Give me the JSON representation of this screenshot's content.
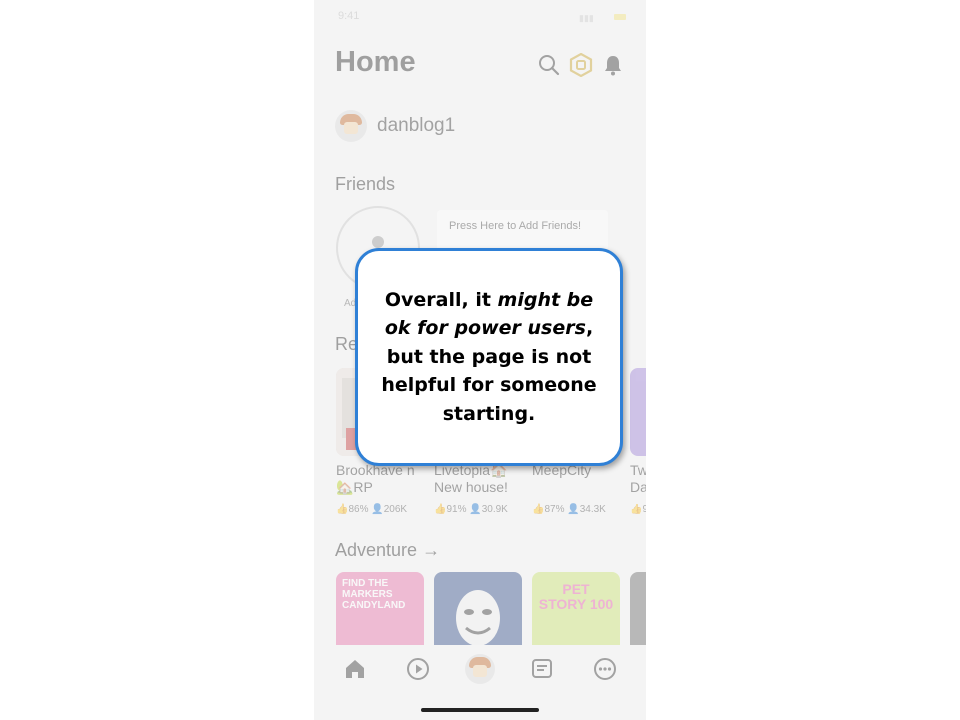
{
  "status_bar": {
    "time": "9:41"
  },
  "header": {
    "title": "Home"
  },
  "user": {
    "name": "danblog1"
  },
  "friends": {
    "label": "Friends",
    "add_caption": "Add Friends",
    "card_text": "Press Here to Add Friends!"
  },
  "recommended": {
    "label": "Recommended",
    "games": [
      {
        "name": "Brookhave n 🏡RP",
        "like": "86%",
        "players": "206K"
      },
      {
        "name": "Livetopia🏠 New house!",
        "like": "91%",
        "players": "30.9K"
      },
      {
        "name": "MeepCity",
        "like": "87%",
        "players": "34.3K"
      },
      {
        "name": "Tw Da",
        "like": "9",
        "players": ""
      }
    ]
  },
  "adventure": {
    "label": "Adventure",
    "tiles": [
      {
        "title": "FIND THE MARKERS CANDYLAND",
        "color": "#e86fa8"
      },
      {
        "title": "",
        "color": "#2f4b87"
      },
      {
        "title": "PET STORY 100",
        "color": "#c7e36b"
      },
      {
        "title": "",
        "color": "#666666"
      }
    ]
  },
  "icons": {
    "search": "search-icon",
    "robux": "robux-icon",
    "bell": "bell-icon",
    "nav": [
      "home-icon",
      "play-icon",
      "avatar-icon",
      "chat-icon",
      "more-icon"
    ]
  },
  "colors": {
    "callout_border": "#2f80d6",
    "background": "#f4f4f4"
  },
  "callout": {
    "part1": "Overall, it ",
    "part2_italic": "might be ok for power users",
    "part3": ", but the page is not helpful for someone starting."
  }
}
